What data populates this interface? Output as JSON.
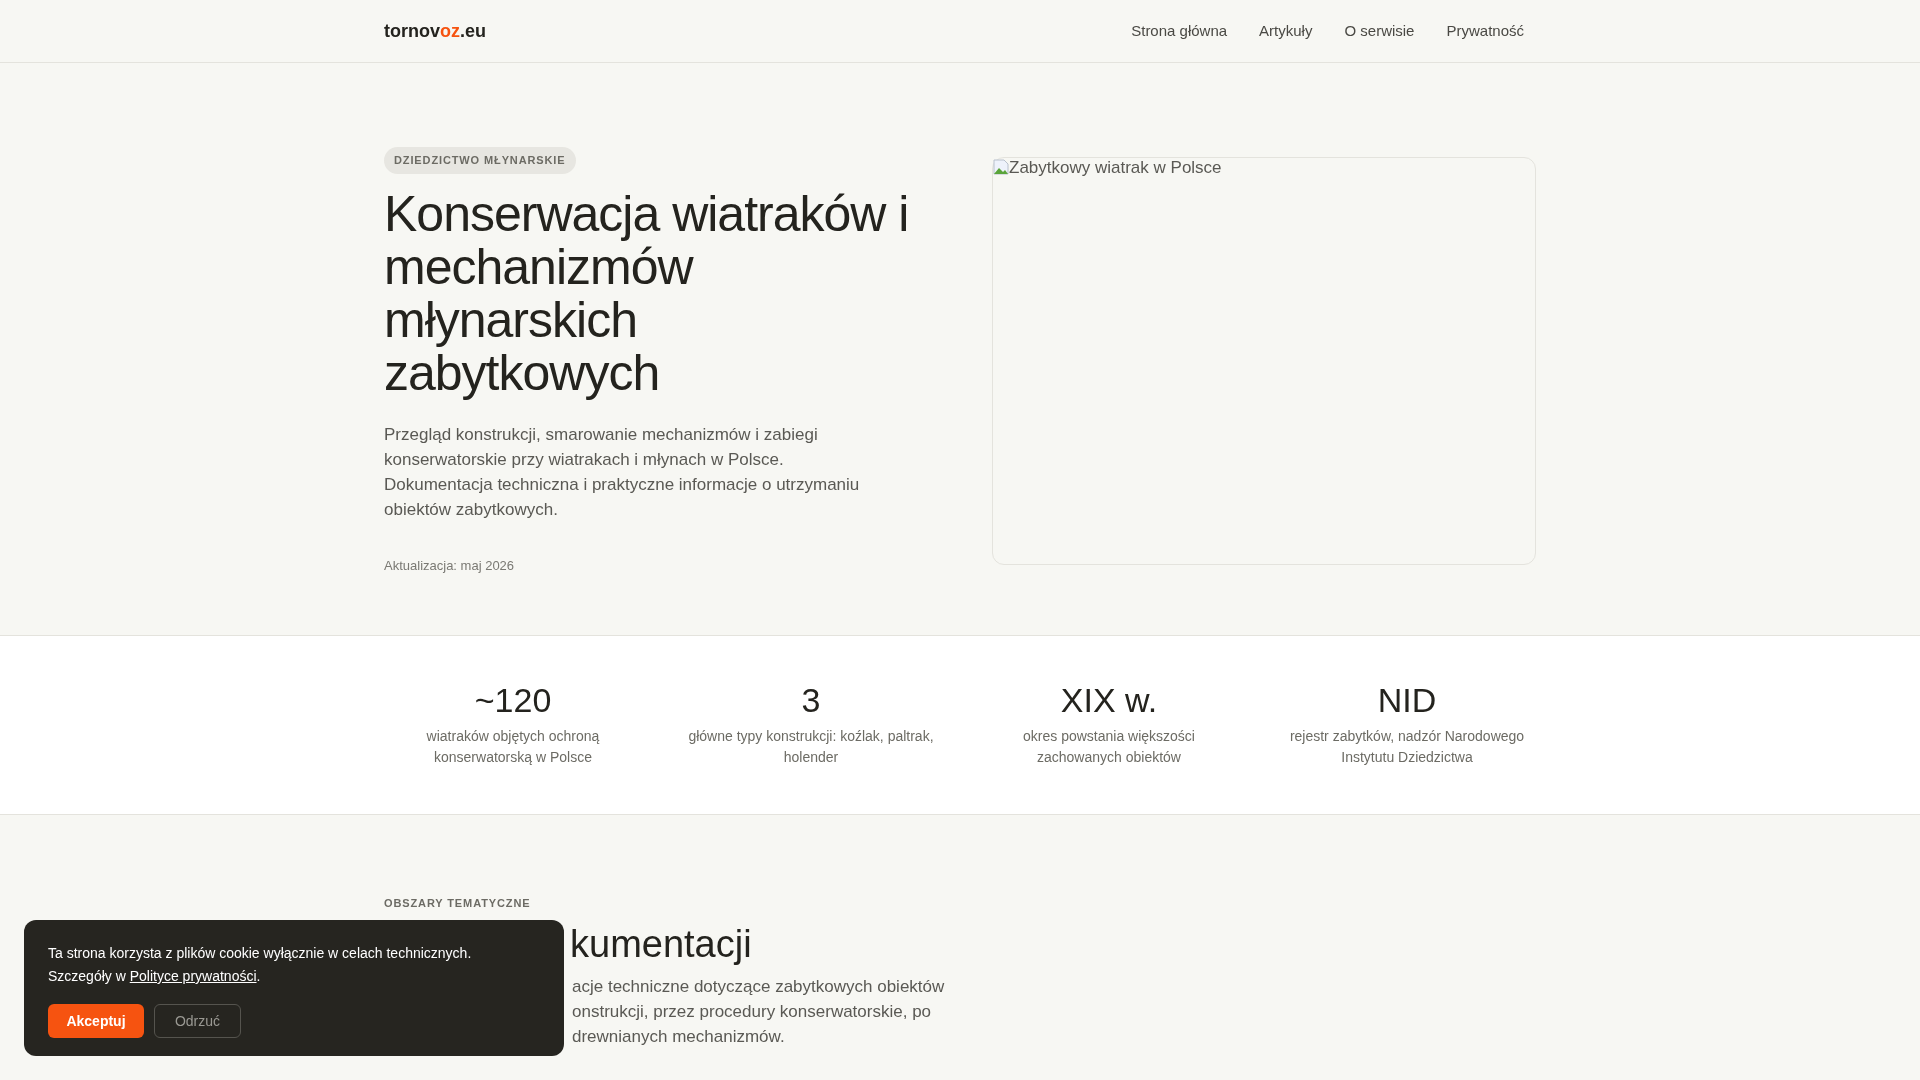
{
  "header": {
    "logo": {
      "before": "tornov",
      "accent": "oz",
      "after": ".eu"
    },
    "nav": [
      {
        "label": "Strona główna"
      },
      {
        "label": "Artykuły"
      },
      {
        "label": "O serwisie"
      },
      {
        "label": "Prywatność"
      }
    ]
  },
  "hero": {
    "tag": "DZIEDZICTWO MŁYNARSKIE",
    "title": "Konserwacja wiatraków i mechanizmów młynarskich zabytkowych",
    "lead": "Przegląd konstrukcji, smarowanie mechanizmów i zabiegi konserwatorskie przy wiatrakach i młynach w Polsce. Dokumentacja techniczna i praktyczne informacje o utrzymaniu obiektów zabytkowych.",
    "updated": "Aktualizacja: maj 2026",
    "image_alt": "Zabytkowy wiatrak w Polsce"
  },
  "stats": [
    {
      "value": "~120",
      "label": "wiatraków objętych ochroną konserwatorską w Polsce"
    },
    {
      "value": "3",
      "label": "główne typy konstrukcji: koźlak, paltrak, holender"
    },
    {
      "value": "XIX w.",
      "label": "okres powstania większości zachowanych obiektów"
    },
    {
      "value": "NID",
      "label": "rejestr zabytków, nadzór Narodowego Instytutu Dziedzictwa"
    }
  ],
  "topics": {
    "eyebrow": "OBSZARY TEMATYCZNE",
    "title_visible": "kumentacji",
    "lines_visible": [
      "acje techniczne dotyczące zabytkowych obiektów",
      "onstrukcji, przez procedury konserwatorskie, po",
      "drewnianych mechanizmów."
    ]
  },
  "cookie": {
    "text": "Ta strona korzysta z plików cookie wyłącznie w celach technicznych.",
    "details": "Szczegóły w",
    "link": "Polityce prywatności",
    "end": ".",
    "accept": "Akceptuj",
    "reject": "Odrzuć"
  }
}
